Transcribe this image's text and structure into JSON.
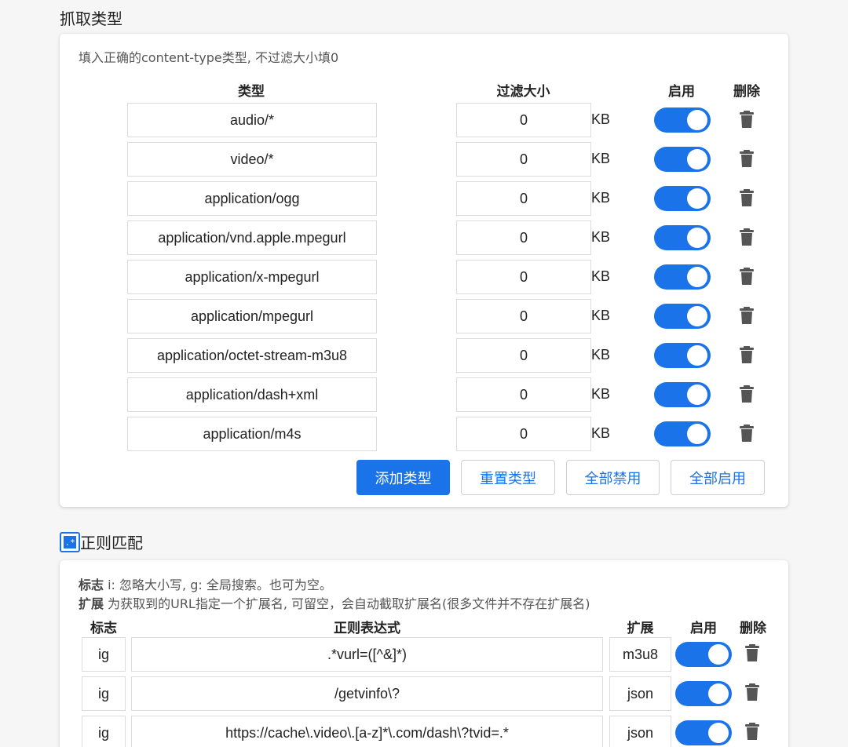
{
  "capture": {
    "title": "抓取类型",
    "hint": "填入正确的content-type类型, 不过滤大小填0",
    "headers": {
      "type": "类型",
      "size": "过滤大小",
      "enable": "启用",
      "delete": "删除"
    },
    "unit": "KB",
    "rows": [
      {
        "type": "audio/*",
        "size": "0",
        "enabled": true
      },
      {
        "type": "video/*",
        "size": "0",
        "enabled": true
      },
      {
        "type": "application/ogg",
        "size": "0",
        "enabled": true
      },
      {
        "type": "application/vnd.apple.mpegurl",
        "size": "0",
        "enabled": true
      },
      {
        "type": "application/x-mpegurl",
        "size": "0",
        "enabled": true
      },
      {
        "type": "application/mpegurl",
        "size": "0",
        "enabled": true
      },
      {
        "type": "application/octet-stream-m3u8",
        "size": "0",
        "enabled": true
      },
      {
        "type": "application/dash+xml",
        "size": "0",
        "enabled": true
      },
      {
        "type": "application/m4s",
        "size": "0",
        "enabled": true
      }
    ],
    "buttons": {
      "add": "添加类型",
      "reset": "重置类型",
      "disable_all": "全部禁用",
      "enable_all": "全部启用"
    }
  },
  "regex": {
    "title": "正则匹配",
    "hint_flag_label": "标志",
    "hint_flag_text": " i: 忽略大小写, g: 全局搜索。也可为空。",
    "hint_ext_label": "扩展",
    "hint_ext_text": " 为获取到的URL指定一个扩展名, 可留空，会自动截取扩展名(很多文件并不存在扩展名)",
    "headers": {
      "flag": "标志",
      "regex": "正则表达式",
      "ext": "扩展",
      "enable": "启用",
      "delete": "删除"
    },
    "rows": [
      {
        "flag": "ig",
        "regex": ".*vurl=([^&]*)",
        "ext": "m3u8",
        "enabled": true
      },
      {
        "flag": "ig",
        "regex": "/getvinfo\\?",
        "ext": "json",
        "enabled": true
      },
      {
        "flag": "ig",
        "regex": "https://cache\\.video\\.[a-z]*\\.com/dash\\?tvid=.*",
        "ext": "json",
        "enabled": true
      }
    ]
  },
  "colors": {
    "accent": "#1a73e8",
    "trash": "#555555"
  }
}
